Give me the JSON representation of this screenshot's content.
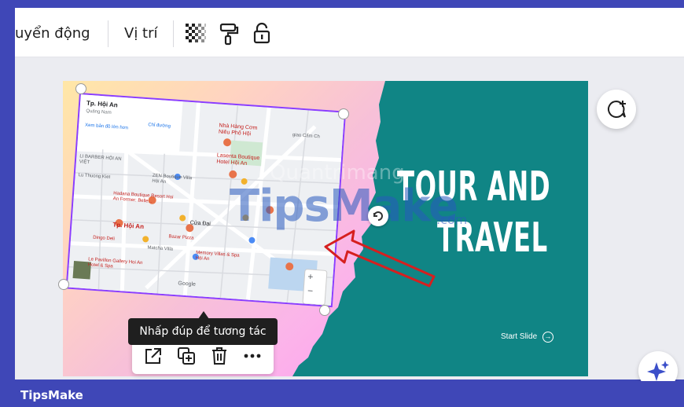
{
  "toolbar": {
    "animate_label": "uyển động",
    "position_label": "Vị trí",
    "icons": [
      "transparency-icon",
      "paint-roller-icon",
      "lock-icon"
    ]
  },
  "slide": {
    "title_line1": "TOUR AND",
    "title_line2": "TRAVEL",
    "start_label": "Start Slide",
    "colors": {
      "teal": "#108585",
      "selection": "#8b3dff"
    }
  },
  "map": {
    "place_title": "Tp. Hội An",
    "place_sub": "Quảng Nam",
    "view_larger": "Xem bản đồ lớn hơn",
    "directions": "Chỉ đường",
    "labels": [
      "Nhà Hàng Cơm Niêu Phố Hội",
      "Lasenta Boutique Hotel Hội An",
      "ZEN Boutique Villa Hội An",
      "Hadana Boutique Resort Hoi An Former: Belle...",
      "Tp. Hội An",
      "Dingo Deli",
      "Cửa Đại",
      "Bazar Pizza",
      "Memory Villas & Spa Hội An",
      "Le Pavillon Gallery Hoi An Hotel & Spa",
      "Lu Thuong Kiet",
      "Matcha Villa",
      "giao Cẩm Ch",
      "Google",
      "LI BARBER HỘI AN VIỆT"
    ]
  },
  "tooltip": "Nhấp đúp để tương tác",
  "context_menu": [
    "open-external-icon",
    "duplicate-icon",
    "trash-icon",
    "more-icon"
  ],
  "side_buttons": [
    "comment-add-icon",
    "magic-sparkle-icon"
  ],
  "watermark": {
    "main": "TipsMake",
    "sub": "Quantrimang",
    "suffix": ".com"
  },
  "footer": {
    "brand": "TipsMake"
  }
}
